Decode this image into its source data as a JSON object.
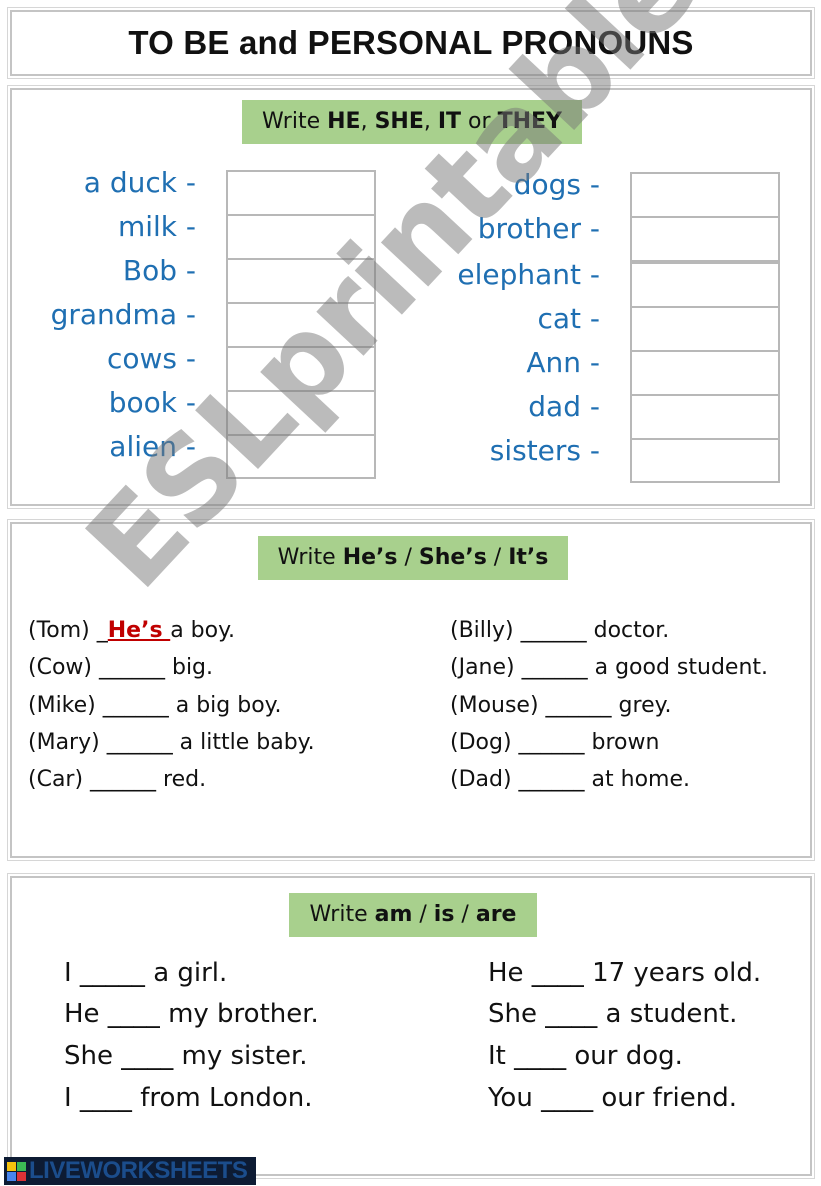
{
  "title": "TO BE and PERSONAL PRONOUNS",
  "section1": {
    "instruction": {
      "prefix": "Write ",
      "parts": [
        {
          "text": "HE",
          "bold": true
        },
        {
          "text": ", ",
          "bold": false
        },
        {
          "text": "SHE",
          "bold": true
        },
        {
          "text": ", ",
          "bold": false
        },
        {
          "text": "IT",
          "bold": true
        },
        {
          "text": " or ",
          "bold": false
        },
        {
          "text": "THEY",
          "bold": true
        }
      ]
    },
    "left_words": [
      "a duck -",
      "milk -",
      "Bob -",
      "grandma -",
      "cows -",
      "book -",
      "alien -"
    ],
    "right_words": [
      "dogs -",
      "brother -",
      "elephant -",
      "cat -",
      "Ann -",
      "dad -",
      "sisters -"
    ],
    "answers_left": [
      "",
      "",
      "",
      "",
      "",
      "",
      ""
    ],
    "answers_right": [
      "",
      "",
      "",
      "",
      "",
      "",
      ""
    ]
  },
  "section2": {
    "instruction": {
      "prefix": "Write ",
      "b1": "He’s",
      "sep1": " / ",
      "b2": "She’s",
      "sep2": " / ",
      "b3": "It’s"
    },
    "left": [
      {
        "subject": "(Tom) ",
        "blank": "_",
        "answer": "He’s ",
        "rest": "a boy."
      },
      {
        "subject": "(Cow) ",
        "blank": "______",
        "answer": "",
        "rest": " big."
      },
      {
        "subject": "(Mike) ",
        "blank": "______",
        "answer": "",
        "rest": " a big boy."
      },
      {
        "subject": "(Mary) ",
        "blank": "______",
        "answer": "",
        "rest": " a little baby."
      },
      {
        "subject": "(Car) ",
        "blank": "______",
        "answer": "",
        "rest": " red."
      }
    ],
    "right": [
      {
        "subject": "(Billy) ",
        "blank": "______",
        "rest": " doctor."
      },
      {
        "subject": "(Jane) ",
        "blank": "______",
        "rest": " a good student."
      },
      {
        "subject": "(Mouse) ",
        "blank": "______",
        "rest": " grey."
      },
      {
        "subject": "(Dog) ",
        "blank": "______",
        "rest": " brown"
      },
      {
        "subject": "(Dad) ",
        "blank": "______",
        "rest": " at home."
      }
    ]
  },
  "section3": {
    "instruction": {
      "prefix": "Write ",
      "b1": "am",
      "sep1": " / ",
      "b2": "is",
      "sep2": " / ",
      "b3": "are"
    },
    "left": [
      "I _____ a girl.",
      "He ____ my brother.",
      "She ____ my sister.",
      "I ____ from London."
    ],
    "right": [
      "He ____ 17 years old.",
      "She ____ a student.",
      "It ____ our dog.",
      "You ____ our friend."
    ]
  },
  "watermark": "ESLprintables.com",
  "footer_logo": {
    "text": "LIVEWORKSHEETS",
    "square_colors": [
      "#f4c20d",
      "#3cba54",
      "#4885ed",
      "#db3236"
    ]
  },
  "colors": {
    "word_blue": "#1f6fb2",
    "banner_green": "#a8d08d",
    "answer_red": "#c00000"
  }
}
